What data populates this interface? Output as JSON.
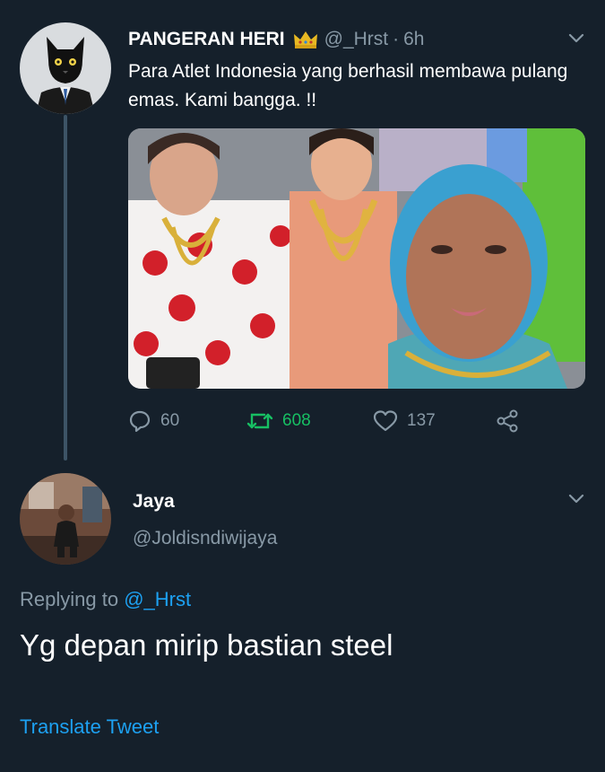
{
  "tweet": {
    "author_name": "PANGERAN HERI",
    "author_badge_icon": "crown-icon",
    "author_handle": "@_Hrst",
    "separator": "·",
    "time": "6h",
    "text": "Para Atlet Indonesia yang berhasil membawa pulang emas. Kami bangga. !!",
    "stats": {
      "replies": "60",
      "retweets": "608",
      "likes": "137"
    },
    "icons": [
      "reply-icon",
      "retweet-icon",
      "like-icon",
      "share-icon",
      "chevron-down-icon"
    ],
    "colors": {
      "retweet_active": "#17bf63",
      "secondary": "#8899a6"
    }
  },
  "reply": {
    "author_name": "Jaya",
    "author_handle": "@Joldisndiwijaya",
    "replying_prefix": "Replying to",
    "replying_mention": "@_Hrst",
    "text": "Yg depan mirip bastian steel",
    "translate_label": "Translate Tweet"
  },
  "theme": {
    "background": "#15202b",
    "link": "#1da1f2",
    "thread_line": "#3d5466"
  }
}
